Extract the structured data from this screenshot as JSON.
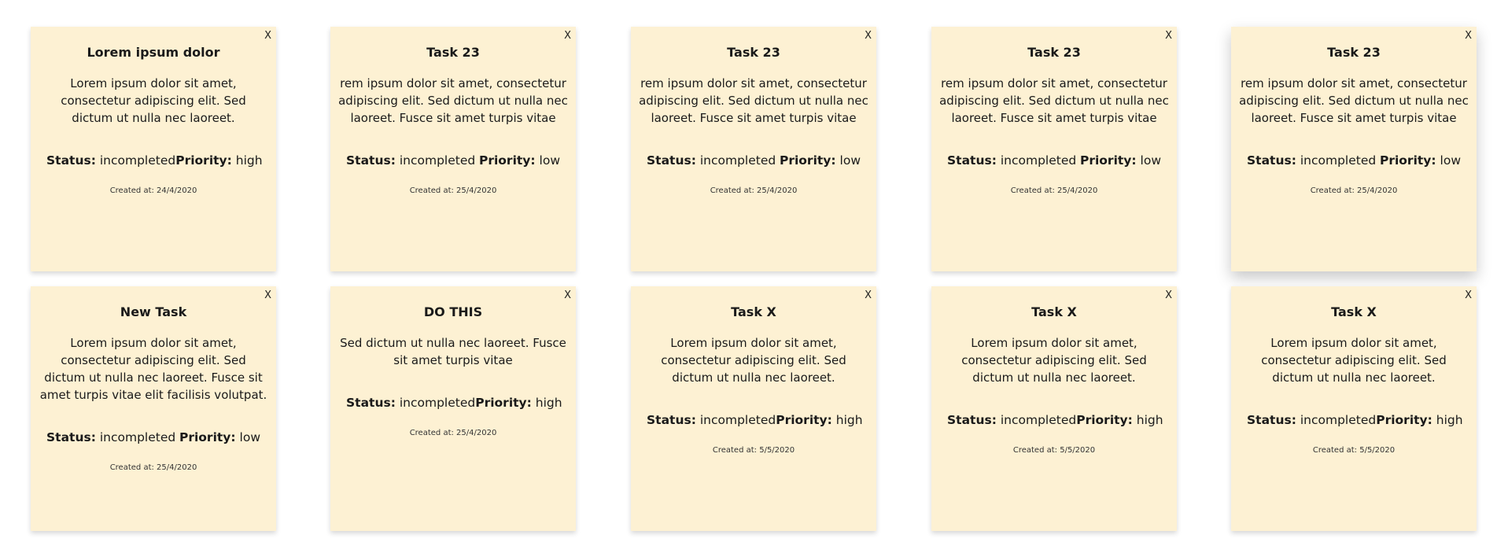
{
  "labels": {
    "close": "X",
    "status": "Status:",
    "priority": "Priority:"
  },
  "notes": [
    {
      "title": "Lorem ipsum dolor",
      "description": "Lorem ipsum dolor sit amet, consectetur adipiscing elit. Sed dictum ut nulla nec laoreet.",
      "status": "incompleted",
      "priority": "high",
      "created": "Created at: 24/4/2020"
    },
    {
      "title": "Task 23",
      "description": "rem ipsum dolor sit amet, consectetur adipiscing elit. Sed dictum ut nulla nec laoreet. Fusce sit amet turpis vitae",
      "status": "incompleted",
      "priority": "low",
      "created": "Created at: 25/4/2020"
    },
    {
      "title": "Task 23",
      "description": "rem ipsum dolor sit amet, consectetur adipiscing elit. Sed dictum ut nulla nec laoreet. Fusce sit amet turpis vitae",
      "status": "incompleted",
      "priority": "low",
      "created": "Created at: 25/4/2020"
    },
    {
      "title": "Task 23",
      "description": "rem ipsum dolor sit amet, consectetur adipiscing elit. Sed dictum ut nulla nec laoreet. Fusce sit amet turpis vitae",
      "status": "incompleted",
      "priority": "low",
      "created": "Created at: 25/4/2020"
    },
    {
      "title": "Task 23",
      "description": "rem ipsum dolor sit amet, consectetur adipiscing elit. Sed dictum ut nulla nec laoreet. Fusce sit amet turpis vitae",
      "status": "incompleted",
      "priority": "low",
      "created": "Created at: 25/4/2020"
    },
    {
      "title": "New Task",
      "description": "Lorem ipsum dolor sit amet, consectetur adipiscing elit. Sed dictum ut nulla nec laoreet. Fusce sit amet turpis vitae elit facilisis volutpat.",
      "status": "incompleted",
      "priority": "low",
      "created": "Created at: 25/4/2020"
    },
    {
      "title": "DO THIS",
      "description": "Sed dictum ut nulla nec laoreet. Fusce sit amet turpis vitae",
      "status": "incompleted",
      "priority": "high",
      "created": "Created at: 25/4/2020"
    },
    {
      "title": "Task X",
      "description": "Lorem ipsum dolor sit amet, consectetur adipiscing elit. Sed dictum ut nulla nec laoreet.",
      "status": "incompleted",
      "priority": "high",
      "created": "Created at: 5/5/2020"
    },
    {
      "title": "Task X",
      "description": "Lorem ipsum dolor sit amet, consectetur adipiscing elit. Sed dictum ut nulla nec laoreet.",
      "status": "incompleted",
      "priority": "high",
      "created": "Created at: 5/5/2020"
    },
    {
      "title": "Task X",
      "description": "Lorem ipsum dolor sit amet, consectetur adipiscing elit. Sed dictum ut nulla nec laoreet.",
      "status": "incompleted",
      "priority": "high",
      "created": "Created at: 5/5/2020"
    }
  ]
}
